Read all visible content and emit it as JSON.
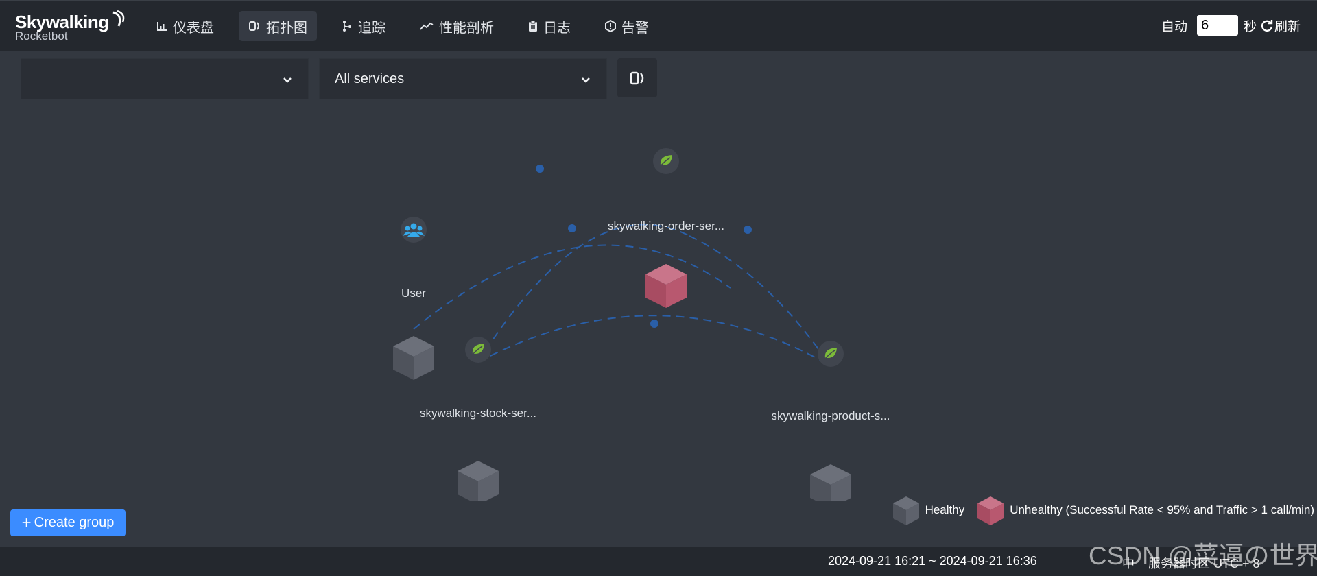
{
  "brand": {
    "name": "Skywalking",
    "sub": "Rocketbot"
  },
  "nav": {
    "items": [
      {
        "label": "仪表盘",
        "icon": "chart-icon"
      },
      {
        "label": "拓扑图",
        "icon": "topology-icon"
      },
      {
        "label": "追踪",
        "icon": "trace-icon"
      },
      {
        "label": "性能剖析",
        "icon": "profile-icon"
      },
      {
        "label": "日志",
        "icon": "log-icon"
      },
      {
        "label": "告警",
        "icon": "alarm-icon"
      }
    ],
    "active_index": 1
  },
  "auto_refresh": {
    "auto_label": "自动",
    "interval": "6",
    "unit": "秒",
    "refresh_label": "刷新"
  },
  "toolbar": {
    "group_select_value": "",
    "service_select_value": "All services"
  },
  "topology": {
    "nodes": [
      {
        "label": "User",
        "type": "user",
        "status": "healthy"
      },
      {
        "label": "skywalking-order-ser...",
        "type": "spring",
        "status": "unhealthy"
      },
      {
        "label": "skywalking-stock-ser...",
        "type": "spring",
        "status": "healthy"
      },
      {
        "label": "skywalking-product-s...",
        "type": "spring",
        "status": "healthy"
      }
    ]
  },
  "create_group": {
    "label": "Create group"
  },
  "legend": {
    "healthy": "Healthy",
    "unhealthy": "Unhealthy (Successful Rate < 95% and Traffic > 1 call/min)"
  },
  "footer": {
    "time_range": "2024-09-21 16:21 ~ 2024-09-21 16:36",
    "lang": "中",
    "timezone": "服务器时区 UTC + 8"
  },
  "watermark": "CSDN @菜逼の世界",
  "colors": {
    "background": "#333840",
    "topbar": "#24282e",
    "primary": "#3b8cff",
    "edge": "#2a5fa8",
    "healthy_node": "#5b5f69",
    "unhealthy_node": "#b8586f",
    "spring_leaf": "#7cbb3a",
    "user_icon": "#35a9ea"
  }
}
